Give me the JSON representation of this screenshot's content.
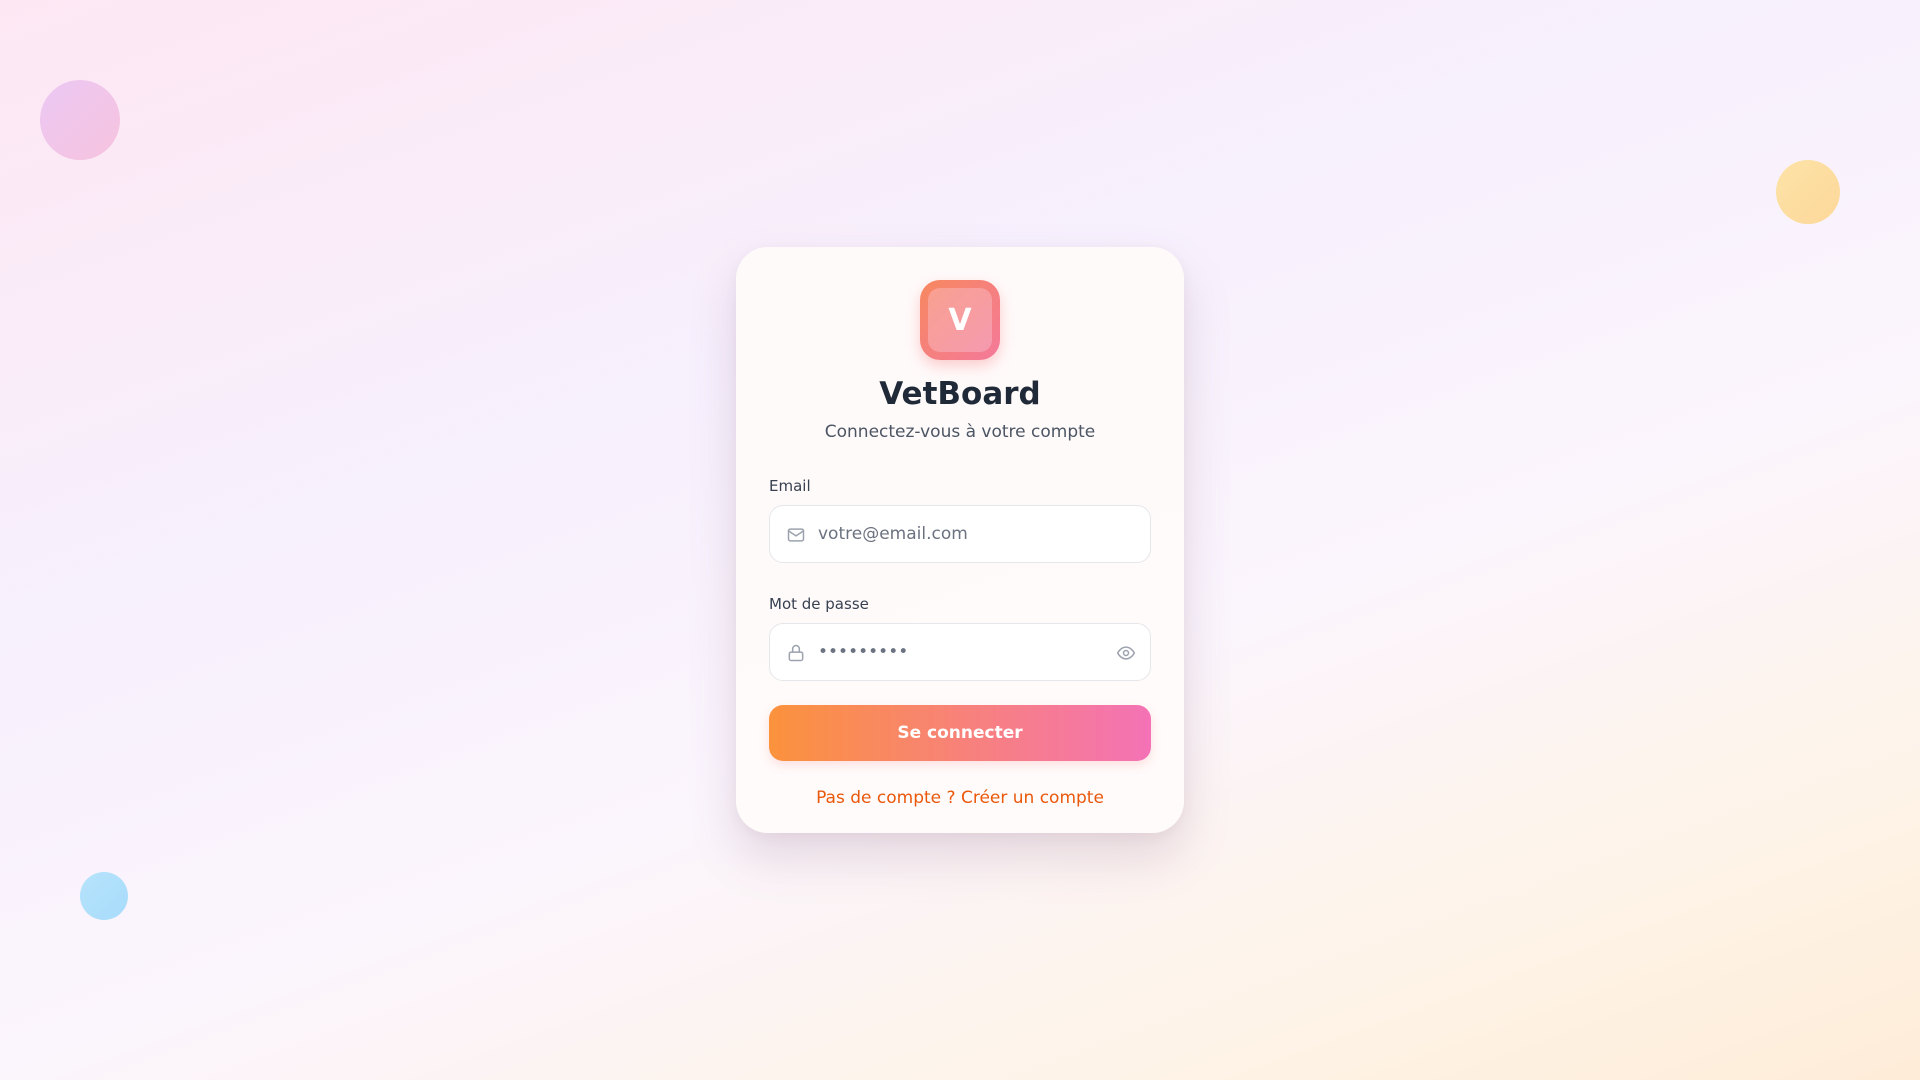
{
  "app": {
    "logo_letter": "V",
    "title": "VetBoard",
    "subtitle": "Connectez-vous à votre compte"
  },
  "form": {
    "email": {
      "label": "Email",
      "placeholder": "votre@email.com",
      "value": "",
      "icon": "mail-icon"
    },
    "password": {
      "label": "Mot de passe",
      "placeholder": "",
      "value": "password1",
      "icon": "lock-icon",
      "toggle_icon": "eye-icon"
    },
    "submit_label": "Se connecter"
  },
  "signup": {
    "prompt": "Pas de compte ?",
    "link_label": "Créer un compte"
  },
  "colors": {
    "accent_start": "#fb923c",
    "accent_end": "#f472b6",
    "link": "#ea580c",
    "title": "#1f2937"
  }
}
